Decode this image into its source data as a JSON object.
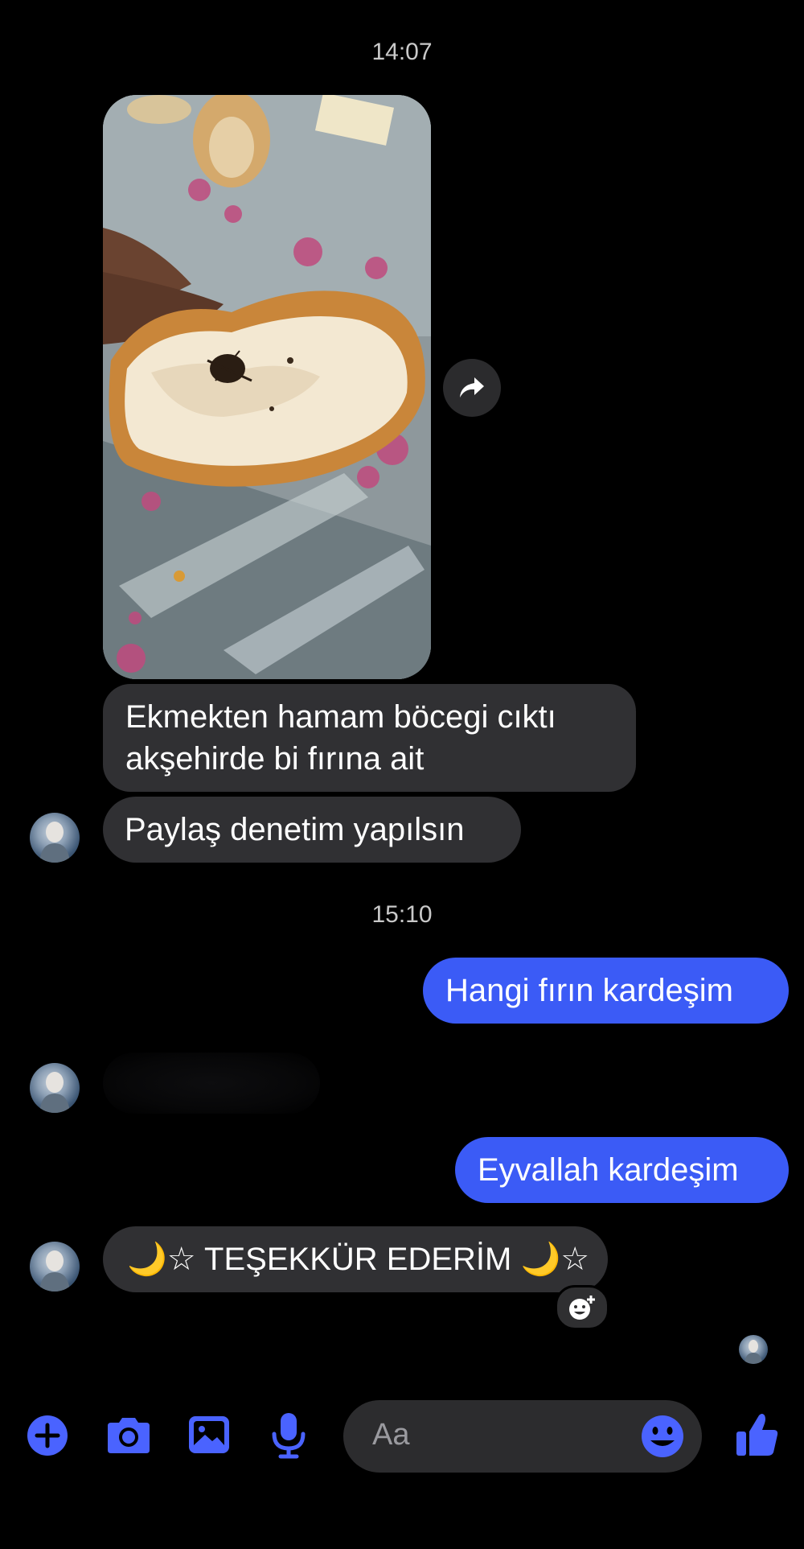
{
  "conversation": {
    "timestamps": [
      "14:07",
      "15:10"
    ],
    "messages": {
      "m1_line1": "Ekmekten hamam böcegi cıktı",
      "m1_line2": "akşehirde bi fırına ait",
      "m2": "Paylaş denetim yapılsın",
      "m3": "Hangi fırın kardeşim",
      "m4": "Eyvallah kardeşim",
      "m5": "🌙☆ TEŞEKKÜR EDERİM 🌙☆"
    }
  },
  "composer": {
    "placeholder": "Aa"
  },
  "icons": {
    "toolbar": [
      "plus-icon",
      "camera-icon",
      "gallery-icon",
      "microphone-icon",
      "emoji-icon",
      "thumbs-up-icon"
    ],
    "message": [
      "share-icon",
      "add-reaction-icon"
    ]
  },
  "colors": {
    "background": "#000000",
    "incoming_bubble": "#303033",
    "outgoing_bubble": "#3b5bf6",
    "accent": "#4a63ff",
    "timestamp": "#c9c9c9"
  }
}
